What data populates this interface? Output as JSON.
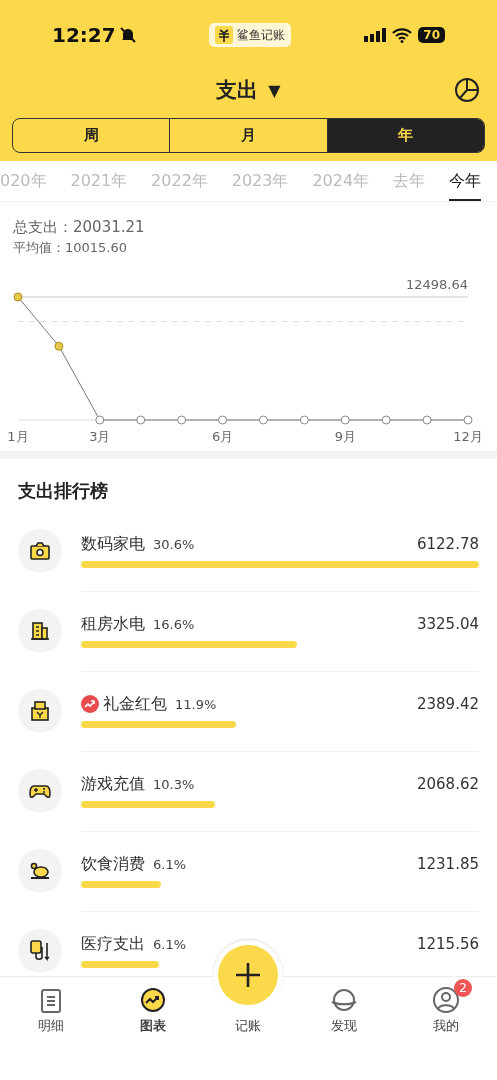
{
  "status_bar": {
    "time": "12:27",
    "app_name": "鲨鱼记账",
    "battery": "70"
  },
  "header": {
    "title": "支出",
    "caret": "▼"
  },
  "period_tabs": [
    {
      "label": "周",
      "selected": false
    },
    {
      "label": "月",
      "selected": false
    },
    {
      "label": "年",
      "selected": true
    }
  ],
  "year_tabs": [
    {
      "label": "020年",
      "selected": false
    },
    {
      "label": "2021年",
      "selected": false
    },
    {
      "label": "2022年",
      "selected": false
    },
    {
      "label": "2023年",
      "selected": false
    },
    {
      "label": "2024年",
      "selected": false
    },
    {
      "label": "去年",
      "selected": false
    },
    {
      "label": "今年",
      "selected": true
    }
  ],
  "summary": {
    "total": "总支出：20031.21",
    "average": "平均值：10015.60"
  },
  "chart": {
    "max_label": "12498.64",
    "month_labels": [
      "1月",
      "3月",
      "6月",
      "9月",
      "12月"
    ]
  },
  "ranking": {
    "title": "支出排行榜",
    "items": [
      {
        "kind": "camera",
        "name": "数码家电",
        "percent": "30.6%",
        "amount": "6122.78",
        "level": 1,
        "trending": false
      },
      {
        "kind": "building",
        "name": "租房水电",
        "percent": "16.6%",
        "amount": "3325.04",
        "level": 0.543,
        "trending": false
      },
      {
        "kind": "envelope",
        "name": "礼金红包",
        "percent": "11.9%",
        "amount": "2389.42",
        "level": 0.389,
        "trending": true
      },
      {
        "kind": "gamepad",
        "name": "游戏充值",
        "percent": "10.3%",
        "amount": "2068.62",
        "level": 0.337,
        "trending": false
      },
      {
        "kind": "food",
        "name": "饮食消费",
        "percent": "6.1%",
        "amount": "1231.85",
        "level": 0.2,
        "trending": false
      },
      {
        "kind": "medical",
        "name": "医疗支出",
        "percent": "6.1%",
        "amount": "1215.56",
        "level": 0.197,
        "trending": false
      }
    ]
  },
  "nav": [
    {
      "kind": "list",
      "label": "明细",
      "selected": false
    },
    {
      "kind": "chart",
      "label": "图表",
      "selected": true
    },
    {
      "kind": "add",
      "label": "记账",
      "selected": false
    },
    {
      "kind": "planet",
      "label": "发现",
      "selected": false
    },
    {
      "kind": "user",
      "label": "我的",
      "selected": false,
      "badge": "2"
    }
  ]
}
